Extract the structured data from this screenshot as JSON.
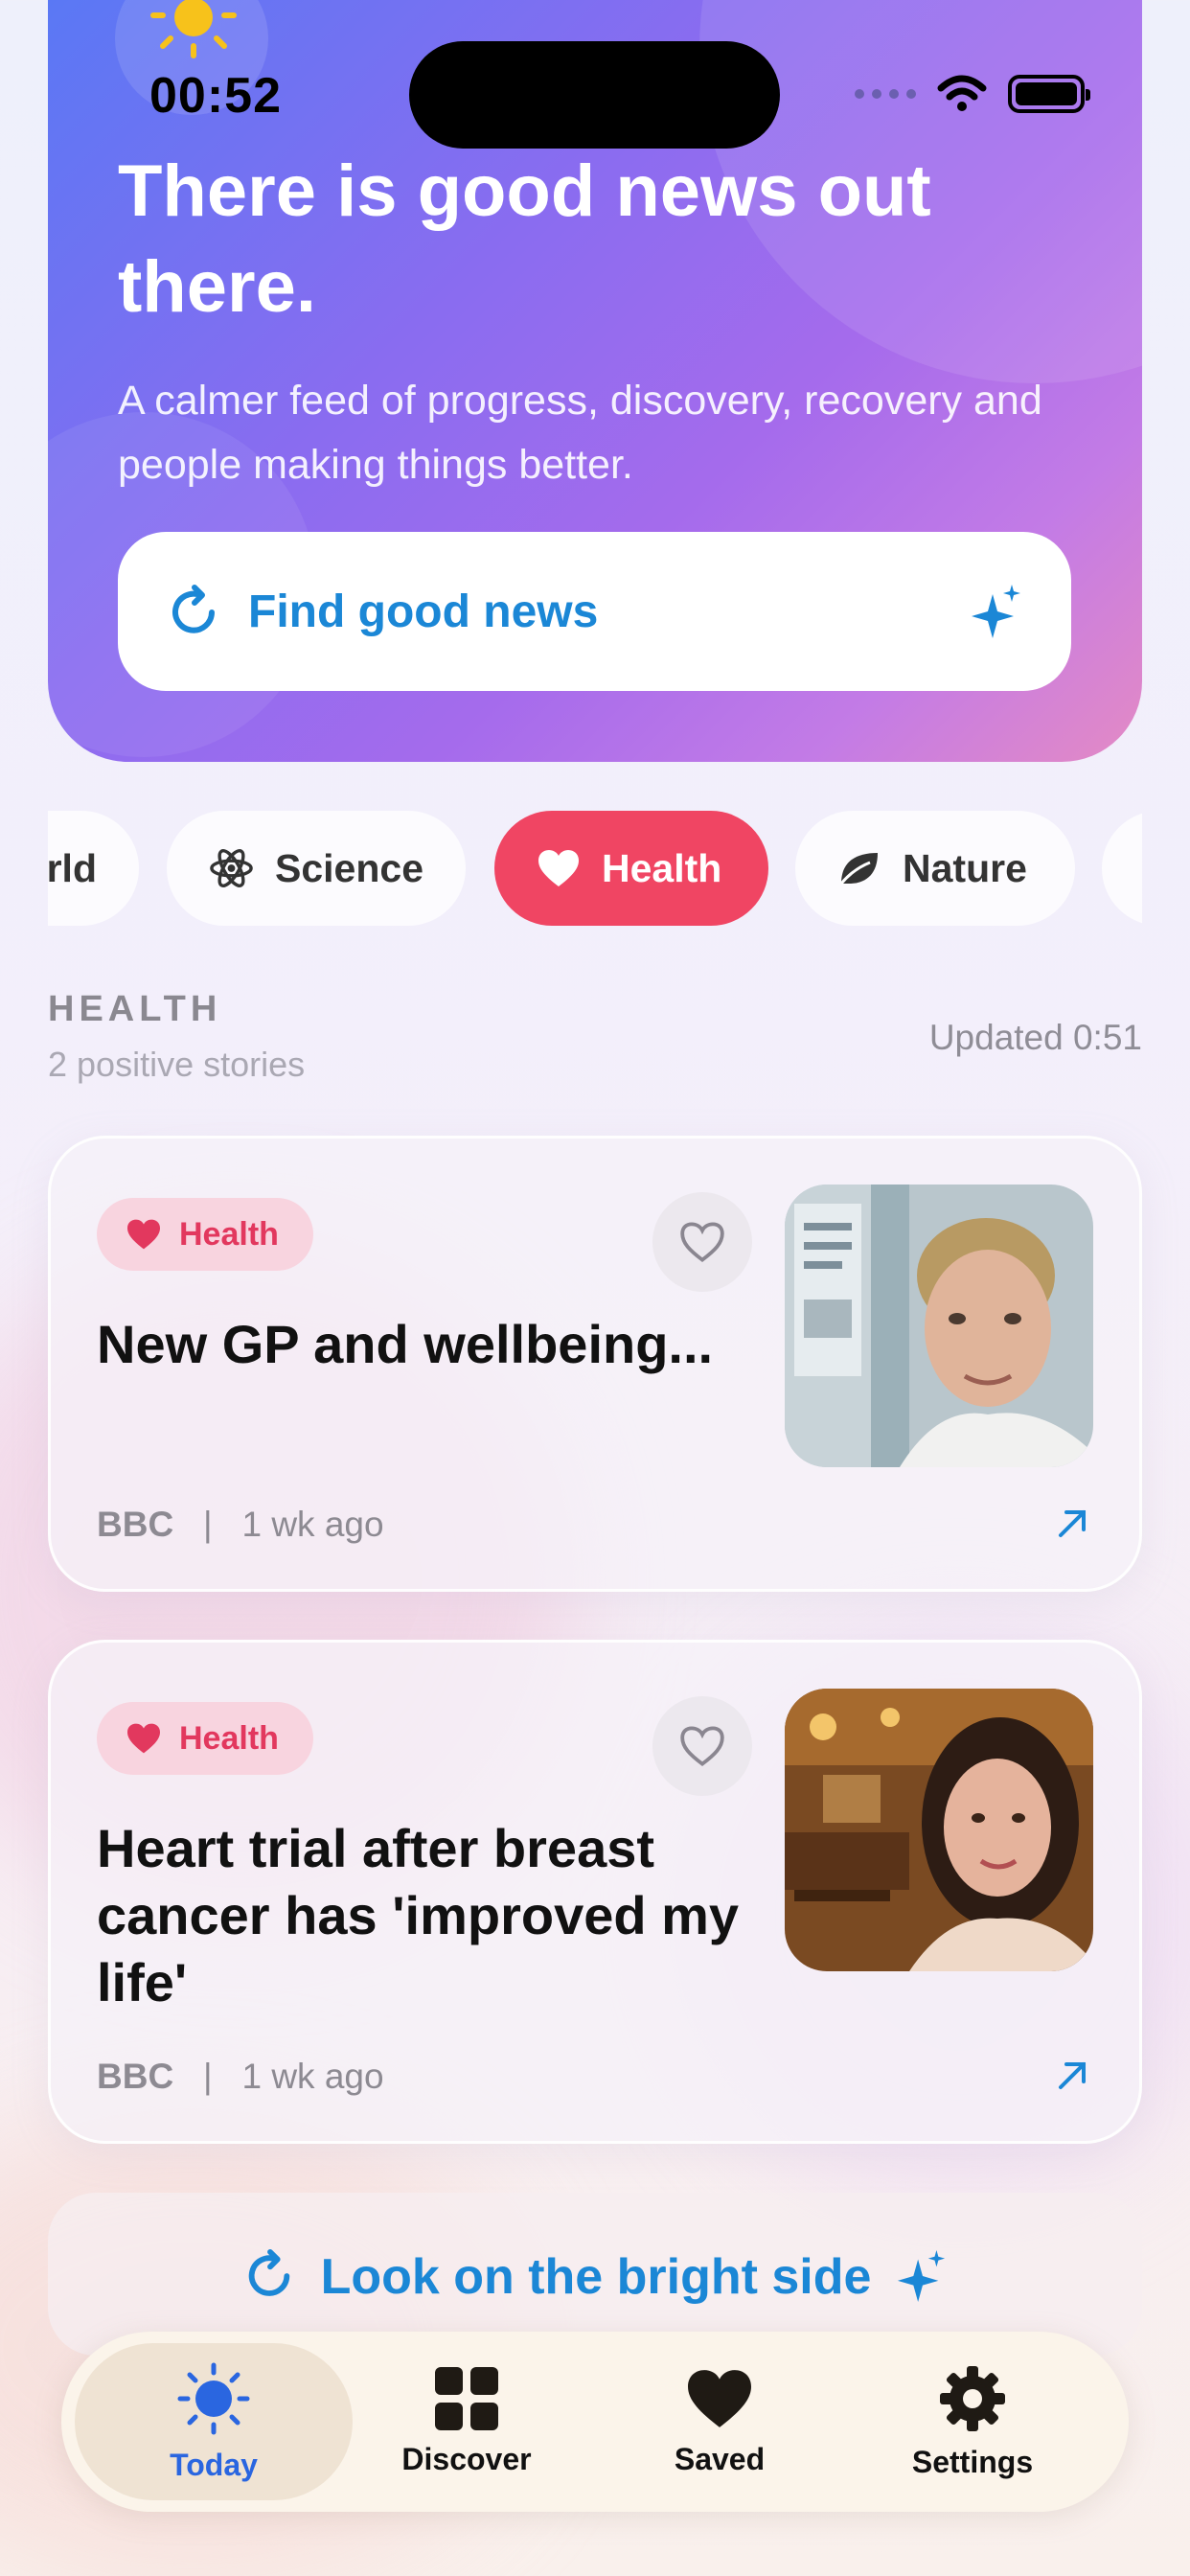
{
  "status_bar": {
    "time": "00:52"
  },
  "hero": {
    "title": "There is good news out there.",
    "subtitle": "A calmer feed of progress, discovery, recovery and people making things better.",
    "find_button": "Find good news"
  },
  "chips": [
    {
      "label": "rld",
      "icon": "globe-icon",
      "active": false
    },
    {
      "label": "Science",
      "icon": "atom-icon",
      "active": false
    },
    {
      "label": "Health",
      "icon": "heart-icon",
      "active": true
    },
    {
      "label": "Nature",
      "icon": "leaf-icon",
      "active": false
    },
    {
      "label": "",
      "icon": "",
      "active": false
    }
  ],
  "section": {
    "heading": "HEALTH",
    "count": "2 positive stories",
    "updated": "Updated 0:51"
  },
  "stories": [
    {
      "badge": "Health",
      "headline": "New GP and wellbeing...",
      "source": "BBC",
      "separator": "|",
      "age": "1 wk ago"
    },
    {
      "badge": "Health",
      "headline": "Heart trial after breast cancer has 'improved my life'",
      "source": "BBC",
      "separator": "|",
      "age": "1 wk ago"
    }
  ],
  "bright_side_button": "Look on the bright side",
  "tabs": [
    {
      "label": "Today",
      "icon": "sun-icon",
      "active": true
    },
    {
      "label": "Discover",
      "icon": "grid-icon",
      "active": false
    },
    {
      "label": "Saved",
      "icon": "heart-icon",
      "active": false
    },
    {
      "label": "Settings",
      "icon": "gear-icon",
      "active": false
    }
  ],
  "colors": {
    "accent_blue": "#1b87d6",
    "health_red": "#f04563",
    "tab_active_blue": "#2a66e0"
  }
}
